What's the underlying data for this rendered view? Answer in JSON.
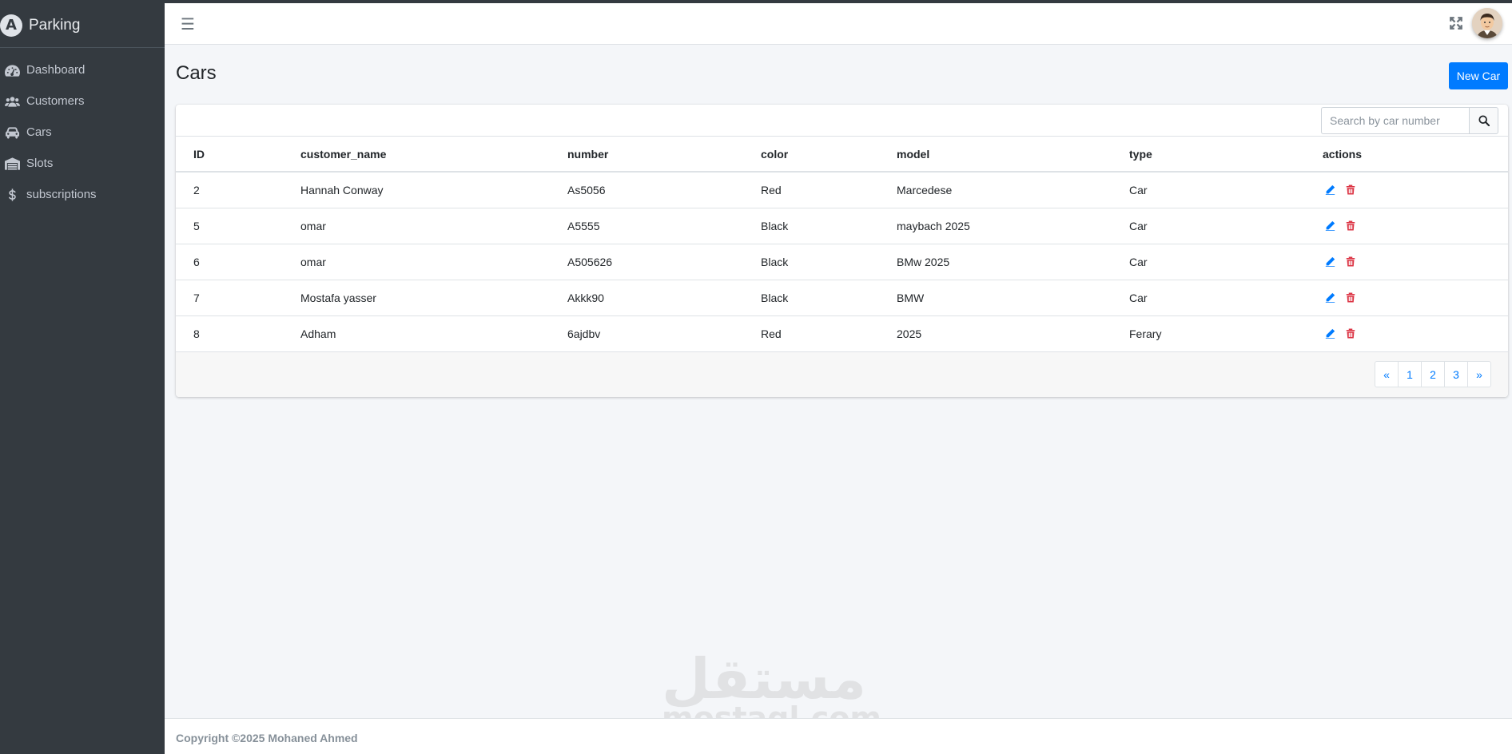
{
  "brand": {
    "name": "Parking",
    "logo_letter": "A"
  },
  "sidebar": {
    "items": [
      {
        "label": "Dashboard",
        "icon": "gauge-icon"
      },
      {
        "label": "Customers",
        "icon": "users-icon"
      },
      {
        "label": "Cars",
        "icon": "car-icon"
      },
      {
        "label": "Slots",
        "icon": "warehouse-icon"
      },
      {
        "label": "subscriptions",
        "icon": "dollar-icon"
      }
    ]
  },
  "header": {
    "menu_icon": "hamburger-icon",
    "expand_icon": "expand-icon",
    "avatar_icon": "user-avatar"
  },
  "page": {
    "title": "Cars",
    "new_button": "New Car"
  },
  "search": {
    "placeholder": "Search by car number",
    "icon": "search-icon"
  },
  "table": {
    "columns": [
      "ID",
      "customer_name",
      "number",
      "color",
      "model",
      "type",
      "actions"
    ],
    "rows": [
      {
        "id": "2",
        "customer_name": "Hannah Conway",
        "number": "As5056",
        "color": "Red",
        "model": "Marcedese",
        "type": "Car"
      },
      {
        "id": "5",
        "customer_name": "omar",
        "number": "A5555",
        "color": "Black",
        "model": "maybach 2025",
        "type": "Car"
      },
      {
        "id": "6",
        "customer_name": "omar",
        "number": "A505626",
        "color": "Black",
        "model": "BMw 2025",
        "type": "Car"
      },
      {
        "id": "7",
        "customer_name": "Mostafa yasser",
        "number": "Akkk90",
        "color": "Black",
        "model": "BMW",
        "type": "Car"
      },
      {
        "id": "8",
        "customer_name": "Adham",
        "number": "6ajdbv",
        "color": "Red",
        "model": "2025",
        "type": "Ferary"
      }
    ]
  },
  "pagination": [
    "«",
    "1",
    "2",
    "3",
    "»"
  ],
  "watermark": {
    "arabic": "مستقل",
    "latin": "mostaql.com"
  },
  "footer": {
    "text": "Copyright ©2025 Mohaned Ahmed"
  },
  "colors": {
    "sidebar": "#343a40",
    "primary": "#007bff",
    "danger": "#dc3545",
    "edit": "#007bff"
  }
}
